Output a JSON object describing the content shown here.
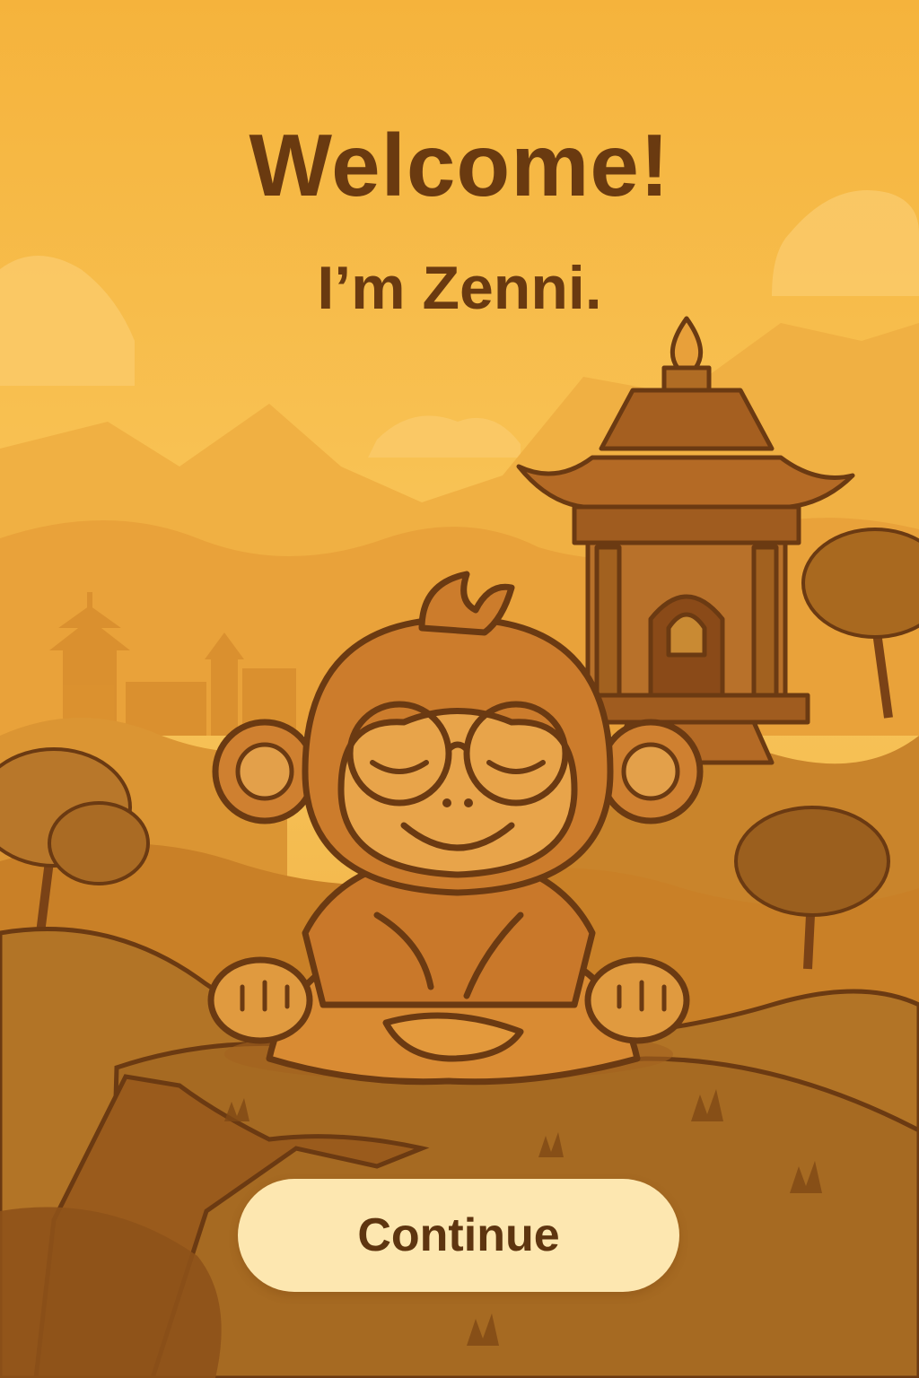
{
  "welcome": {
    "heading": "Welcome!",
    "subheading": "I’m Zenni.",
    "continue_label": "Continue"
  },
  "colors": {
    "sky": "#f7bd48",
    "title_text": "#6a3a10",
    "button_bg": "#fde7b0",
    "button_text": "#5e3510",
    "outline": "#6b3a12"
  },
  "illustration": {
    "character": "monkey-mascot",
    "elements": [
      "clouds",
      "mountains",
      "pagoda",
      "distant-village",
      "trees",
      "hill"
    ]
  }
}
